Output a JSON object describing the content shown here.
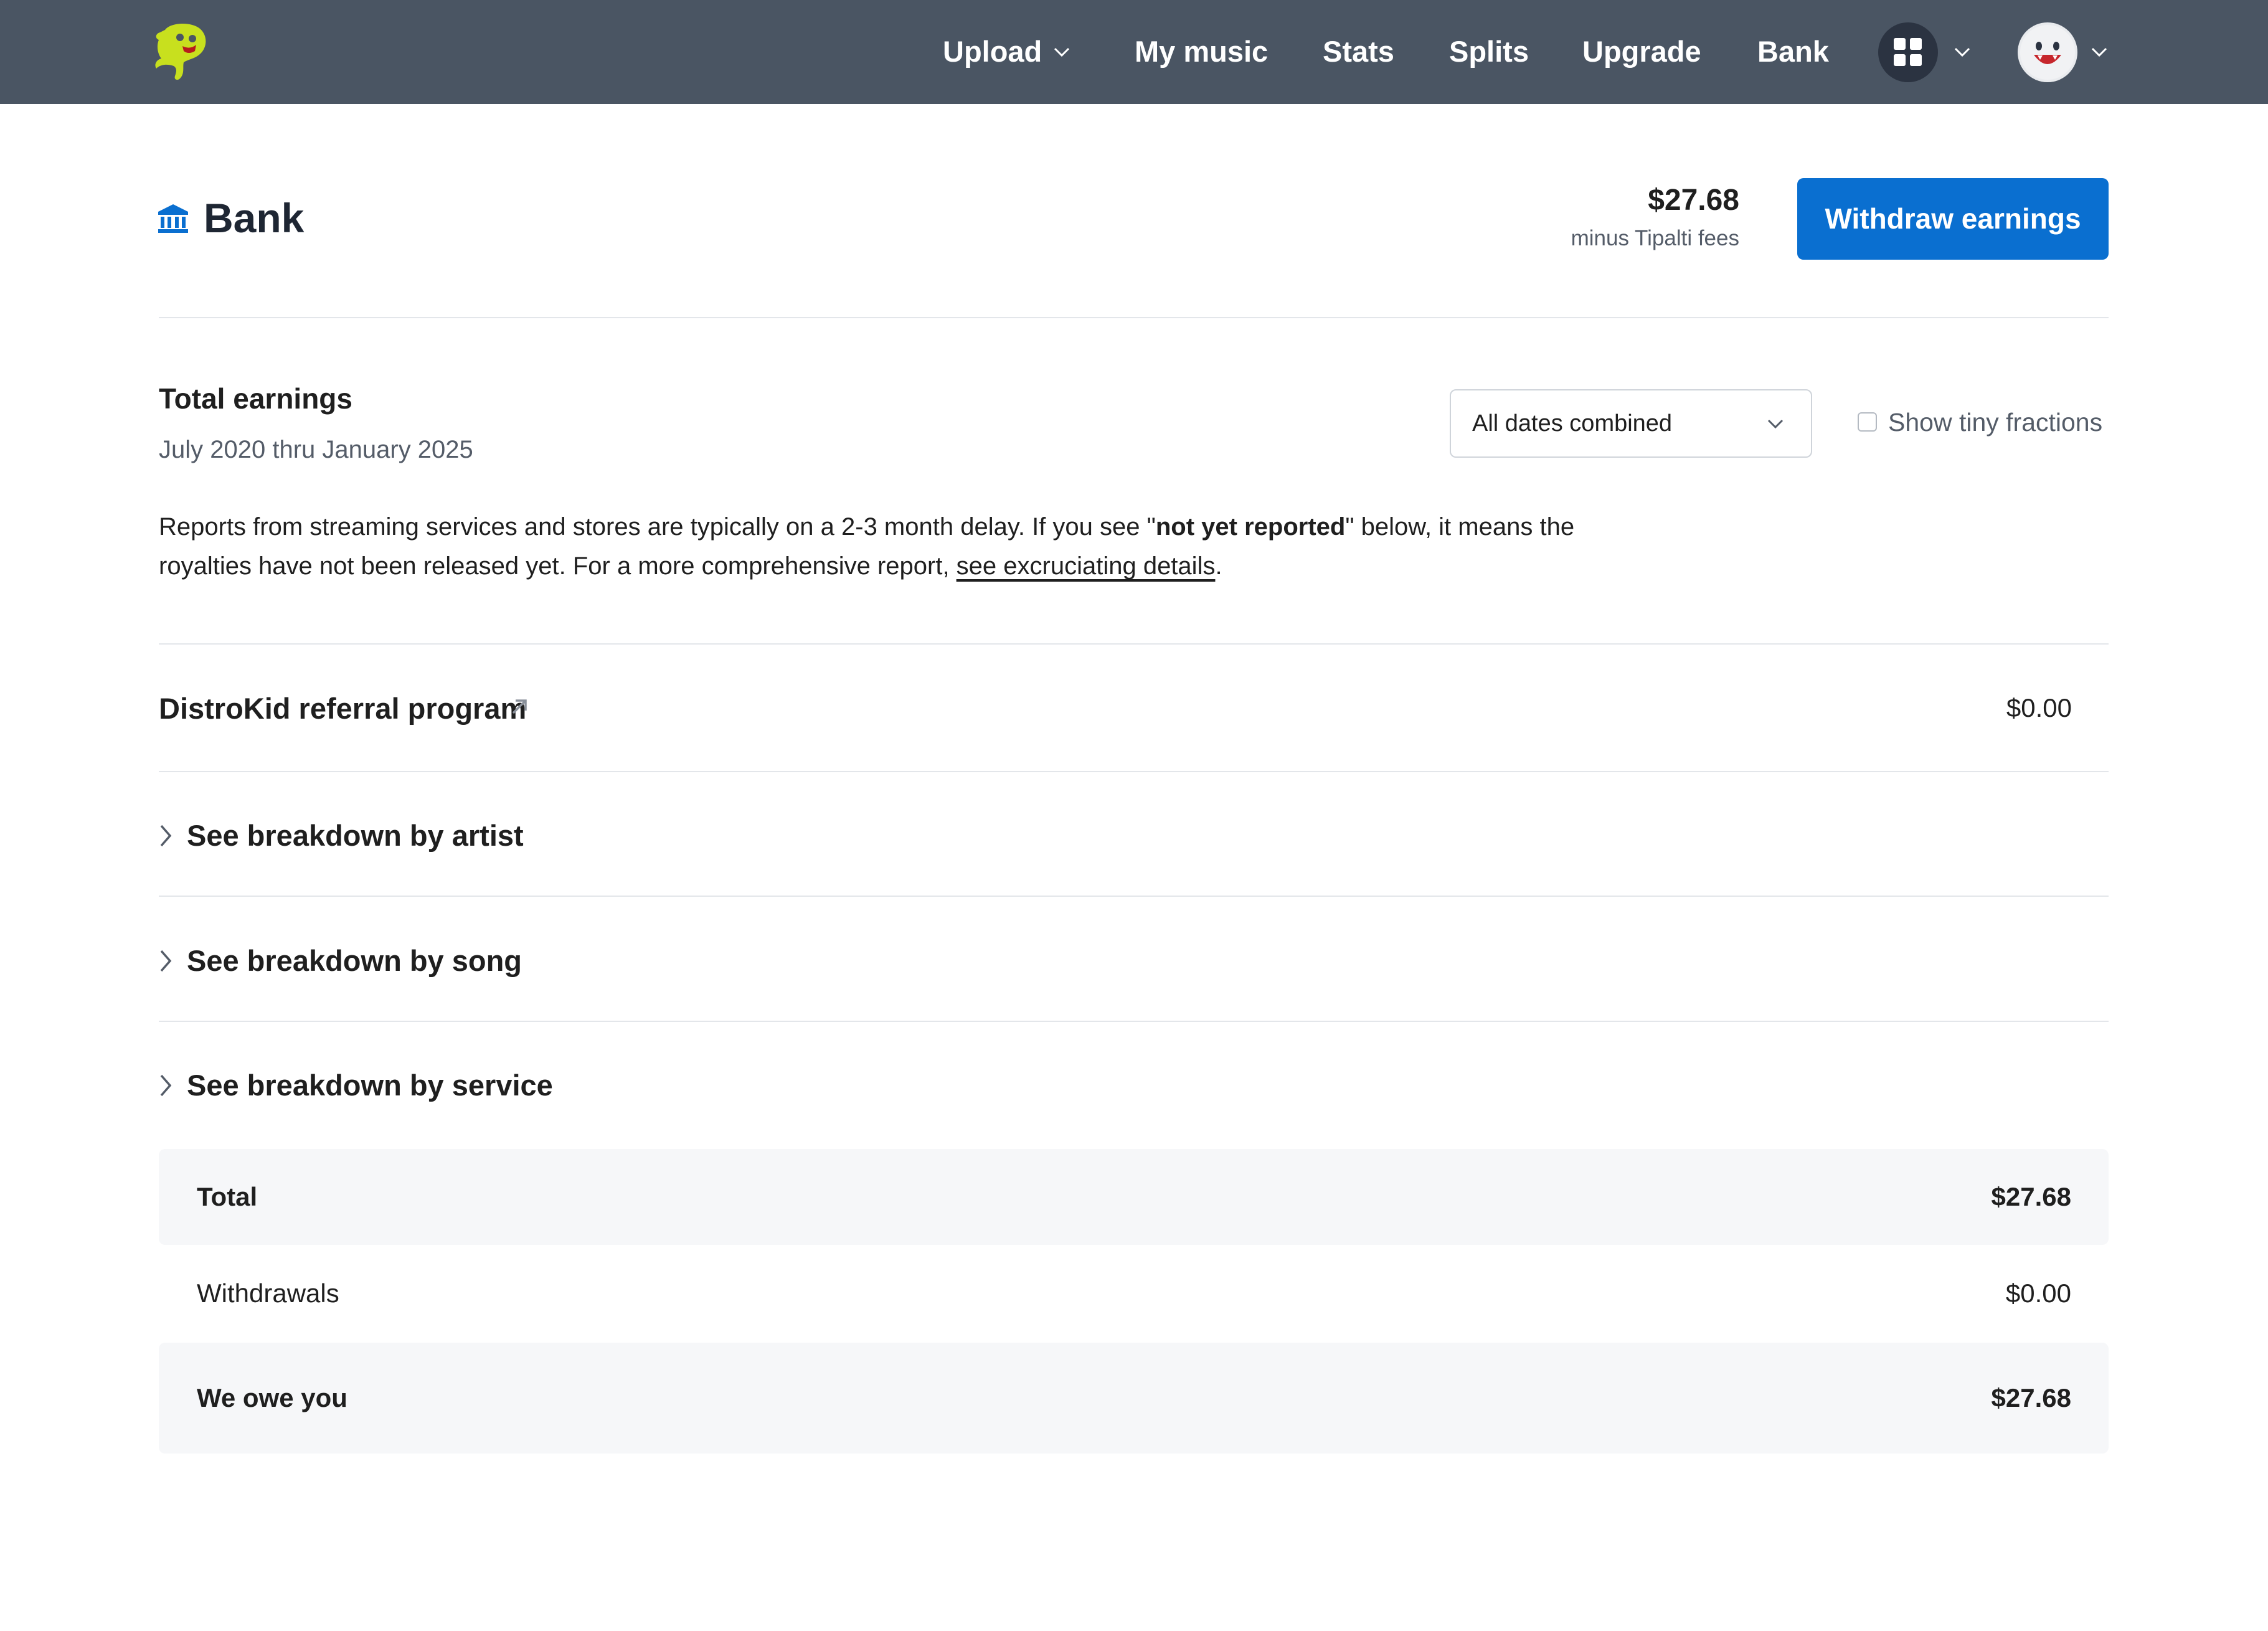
{
  "nav": {
    "items": [
      {
        "label": "Upload"
      },
      {
        "label": "My music"
      },
      {
        "label": "Stats"
      },
      {
        "label": "Splits"
      },
      {
        "label": "Upgrade"
      },
      {
        "label": "Bank"
      }
    ],
    "colors": {
      "background": "#4a5563",
      "logo": "#c8e01e"
    },
    "icons": [
      "distrokid-logo-icon",
      "chevron-down-icon",
      "apps-grid-icon",
      "avatar-icon"
    ]
  },
  "header": {
    "icon": "bank-icon",
    "title": "Bank",
    "balance": "$27.68",
    "balance_note": "minus Tipalti fees",
    "withdraw_label": "Withdraw earnings",
    "accent": "#0a6fd0"
  },
  "earnings": {
    "title": "Total earnings",
    "date_range": "July 2020 thru January 2025",
    "date_filter": {
      "selected": "All dates combined"
    },
    "tiny_fractions": {
      "label": "Show tiny fractions",
      "checked": false
    },
    "notice": {
      "part1": "Reports from streaming services and stores are typically on a 2-3 month delay. If you see \"",
      "bold": "not yet reported",
      "part2": "\" below, it means the royalties have not been released yet. For a more comprehensive report, ",
      "link": "see excruciating details",
      "part3": "."
    }
  },
  "referral": {
    "label": "DistroKid referral program",
    "value": "$0.00"
  },
  "breakdowns": [
    {
      "label": "See breakdown by artist"
    },
    {
      "label": "See breakdown by song"
    },
    {
      "label": "See breakdown by service"
    }
  ],
  "totals": {
    "total_label": "Total",
    "total_value": "$27.68",
    "withdrawals_label": "Withdrawals",
    "withdrawals_value": "$0.00",
    "owe_label": "We owe you",
    "owe_value": "$27.68"
  }
}
